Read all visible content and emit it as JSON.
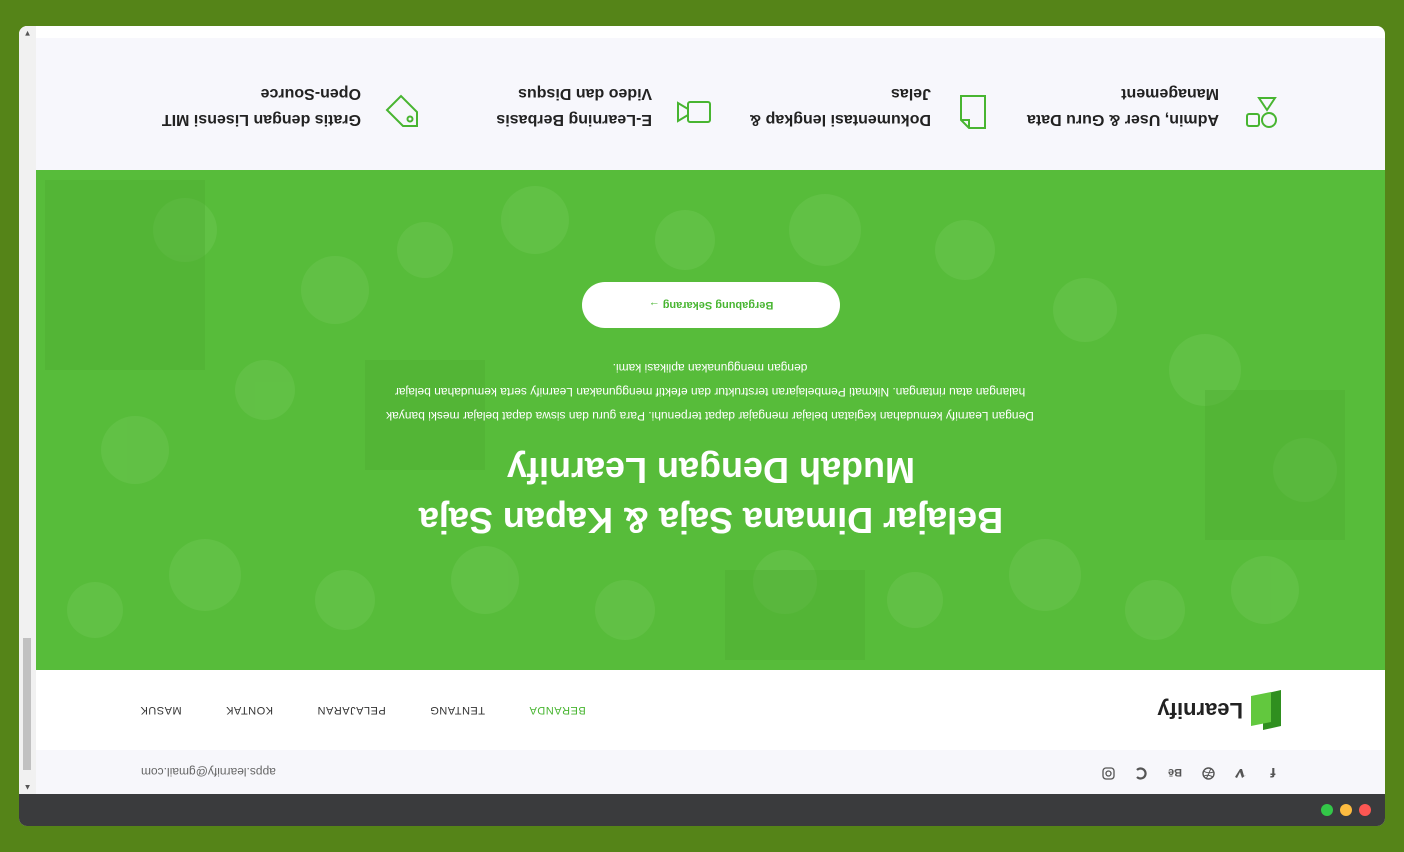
{
  "topbar": {
    "email": "apps.learnify@gmail.com",
    "socials": [
      "facebook-icon",
      "vimeo-icon",
      "dribbble-icon",
      "behance-icon",
      "opencollective-icon",
      "instagram-icon"
    ]
  },
  "navbar": {
    "logo_text": "Learnify",
    "items": [
      {
        "label": "BERANDA",
        "active": true
      },
      {
        "label": "TENTANG",
        "active": false
      },
      {
        "label": "PELAJARAN",
        "active": false
      },
      {
        "label": "KONTAK",
        "active": false
      },
      {
        "label": "MASUK",
        "active": false
      }
    ]
  },
  "hero": {
    "title": "Belajar Dimana Saja & Kapan Saja Mudah Dengan Learnify",
    "description": "Dengan Learnify kemudahan kegiatan belajar mengajar dapat terpenuhi. Para guru dan siswa dapat belajar meski banyak halangan atau rintangan. Nikmati Pembelajaran terstruktur dan efektif menggunakan Learnify serta kemudahan belajar dengan menggunakan aplikasi kami.",
    "cta_label": "Bergabung Sekarang →"
  },
  "features": [
    {
      "icon": "shapes-icon",
      "title": "Admin, User & Guru Data Management"
    },
    {
      "icon": "document-icon",
      "title": "Dokumentasi lengkap & Jelas"
    },
    {
      "icon": "video-icon",
      "title": "E-Learning Berbasis Video dan Disqus"
    },
    {
      "icon": "tag-icon",
      "title": "Gratis dengan Lisensi MIT Open-Source"
    }
  ],
  "colors": {
    "accent": "#48b531",
    "hero_bg": "#57bc3a",
    "desktop_bg": "#558418",
    "titlebar": "#3a3b3d"
  }
}
